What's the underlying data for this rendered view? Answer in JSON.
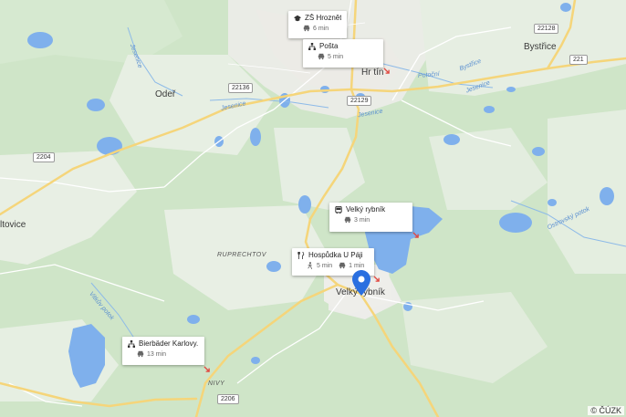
{
  "towns": {
    "oder": "Odeř",
    "hroznetin": "Hr     tín",
    "bystrice": "Bystřice",
    "velky_rybnik": "Velký rybník",
    "ltovice": "ltovice"
  },
  "areas": {
    "ruprechtov": "RUPRECHTOV",
    "nivy": "NIVY"
  },
  "streams": {
    "jesenice_a": "Jesenice",
    "jesenice_b": "Jesenice",
    "jesenice_c": "Jesenice",
    "jesenice_d": "Jesenice",
    "bystrice": "Bystřice",
    "potocni": "Potoční",
    "ostrovsky": "Ostrovský potok",
    "vitkuvsky": "Vitkův potok"
  },
  "roads": [
    "22128",
    "221",
    "22136",
    "22129",
    "2204",
    "2206"
  ],
  "cards": {
    "school": {
      "title": "ZŠ Hroznětín",
      "time": "6 min",
      "icon": "graduation-cap-icon",
      "mode": "car-icon"
    },
    "post": {
      "title": "Pošta",
      "time": "5 min",
      "icon": "sitemap-icon",
      "mode": "car-icon"
    },
    "bus": {
      "title": "Velký rybník",
      "time": "3 min",
      "icon": "bus-icon",
      "mode": "car-icon"
    },
    "pub": {
      "title": "Hospůdka U Páji",
      "walk_time": "5 min",
      "car_time": "1 min",
      "icon": "fork-knife-icon",
      "walk_icon": "walker-icon",
      "car_icon": "car-icon"
    },
    "spa": {
      "title": "Bierbäder Karlovy...",
      "time": "13 min",
      "icon": "sitemap-icon",
      "mode": "car-icon"
    }
  },
  "copyright": "© ČÚZK",
  "colors": {
    "water": "#7fb0ec",
    "forest": "#cde4c6",
    "open": "#e9efe4",
    "road_major": "#f6d987",
    "pin": "#2a6fe0",
    "arrow": "#e0473f"
  }
}
